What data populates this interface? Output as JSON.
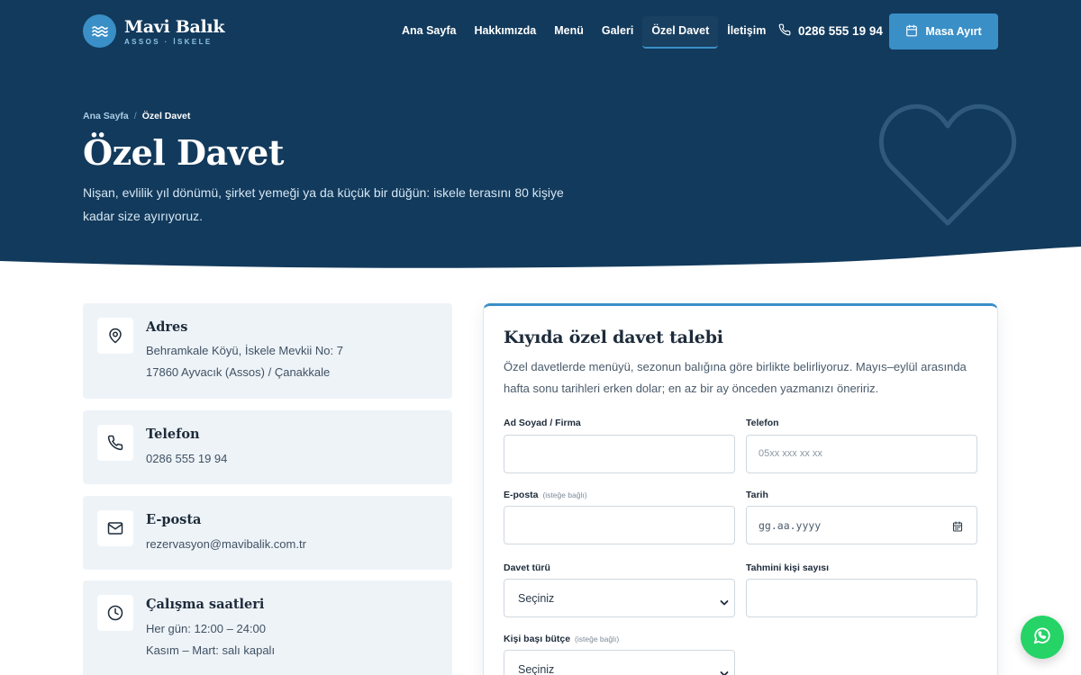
{
  "brand": {
    "name": "Mavi Balık",
    "subtitle": "ASSOS · İSKELE"
  },
  "nav": {
    "items": [
      {
        "label": "Ana Sayfa",
        "active": false
      },
      {
        "label": "Hakkımızda",
        "active": false
      },
      {
        "label": "Menü",
        "active": false
      },
      {
        "label": "Galeri",
        "active": false
      },
      {
        "label": "Özel Davet",
        "active": true
      },
      {
        "label": "İletişim",
        "active": false
      }
    ],
    "phone": "0286 555 19 94",
    "reserve_label": "Masa Ayırt"
  },
  "breadcrumb": {
    "home": "Ana Sayfa",
    "separator": "/",
    "current": "Özel Davet"
  },
  "hero": {
    "title": "Özel Davet",
    "description": "Nişan, evlilik yıl dönümü, şirket yemeği ya da küçük bir düğün: iskele terasını 80 kişiye kadar size ayırıyoruz."
  },
  "info": {
    "address": {
      "title": "Adres",
      "line1": "Behramkale Köyü, İskele Mevkii No: 7",
      "line2": "17860 Ayvacık (Assos) / Çanakkale"
    },
    "phone": {
      "title": "Telefon",
      "line1": "0286 555 19 94"
    },
    "email": {
      "title": "E-posta",
      "line1": "rezervasyon@mavibalik.com.tr"
    },
    "hours": {
      "title": "Çalışma saatleri",
      "line1": "Her gün: 12:00 – 24:00",
      "line2": "Kasım – Mart: salı kapalı"
    }
  },
  "form": {
    "title": "Kıyıda özel davet talebi",
    "description": "Özel davetlerde menüyü, sezonun balığına göre birlikte belirliyoruz. Mayıs–eylül arasında hafta sonu tarihleri erken dolar; en az bir ay önceden yazmanızı öneririz.",
    "name": {
      "label": "Ad Soyad / Firma",
      "value": ""
    },
    "phone": {
      "label": "Telefon",
      "placeholder": "05xx xxx xx xx"
    },
    "email": {
      "label": "E-posta",
      "optional": "(isteğe bağlı)",
      "value": ""
    },
    "date": {
      "label": "Tarih",
      "placeholder": "gg.aa.yyyy"
    },
    "event_type": {
      "label": "Davet türü",
      "selected": "Seçiniz"
    },
    "guests": {
      "label": "Tahmini kişi sayısı",
      "value": ""
    },
    "budget": {
      "label": "Kişi başı bütçe",
      "optional": "(isteğe bağlı)",
      "selected": "Seçiniz"
    }
  },
  "colors": {
    "hero_bg": "#123a5c",
    "accent": "#3a8fc7",
    "card_bg": "#eef3f8",
    "whatsapp": "#25d366"
  },
  "icons": {
    "logo": "waves-icon",
    "phone": "phone-icon",
    "reserve": "calendar-icon",
    "address": "map-pin-icon",
    "email": "mail-icon",
    "hours": "clock-icon",
    "hero_decoration": "heart-icon",
    "chat": "whatsapp-icon"
  }
}
